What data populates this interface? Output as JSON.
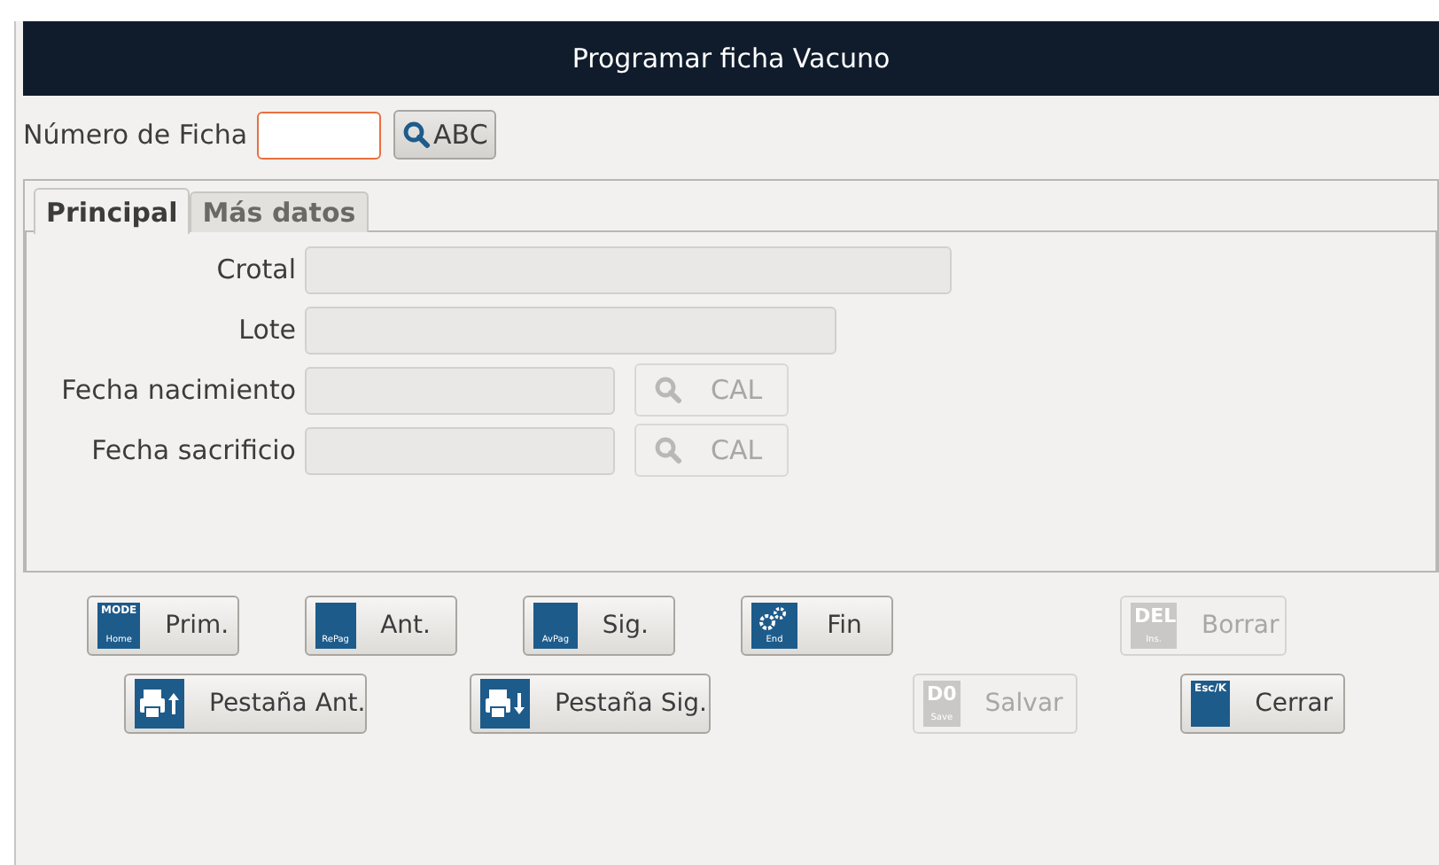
{
  "window": {
    "title": "Programar ficha Vacuno"
  },
  "lookup": {
    "label": "Número de Ficha",
    "focused": true,
    "button": "ABC"
  },
  "tabs": [
    {
      "label": "Principal",
      "selected": true
    },
    {
      "label": "Más datos",
      "selected": false
    }
  ],
  "fields": [
    {
      "kind": "text",
      "label": "Crotal",
      "disabled": true
    },
    {
      "kind": "text",
      "label": "Lote",
      "disabled": true
    },
    {
      "kind": "date",
      "label": "Fecha nacimiento",
      "disabled": true,
      "button": "CAL"
    },
    {
      "kind": "date",
      "label": "Fecha sacrificio",
      "disabled": true,
      "button": "CAL"
    }
  ],
  "button_rows": [
    [
      {
        "kind": "key",
        "key": "MODE",
        "key_sub": "Home",
        "label": "Prim.",
        "disabled": false
      },
      {
        "kind": "key",
        "key_sub": "RePag",
        "label": "Ant.",
        "disabled": false
      },
      {
        "kind": "key",
        "key_sub": "AvPag",
        "label": "Sig.",
        "disabled": false
      },
      {
        "kind": "gears",
        "key_sub": "End",
        "label": "Fin",
        "disabled": false
      },
      {
        "kind": "key",
        "key": "DEL",
        "key_sub": "Ins.",
        "label": "Borrar",
        "disabled": true
      }
    ],
    [
      {
        "kind": "print-up",
        "label": "Pestaña Ant.",
        "disabled": false
      },
      {
        "kind": "print-down",
        "label": "Pestaña Sig.",
        "disabled": false
      },
      {
        "kind": "key",
        "key": "D0",
        "key_sub": "Save",
        "label": "Salvar",
        "disabled": true
      },
      {
        "kind": "key",
        "key": "Esc/K",
        "label": "Cerrar",
        "disabled": false
      }
    ]
  ]
}
